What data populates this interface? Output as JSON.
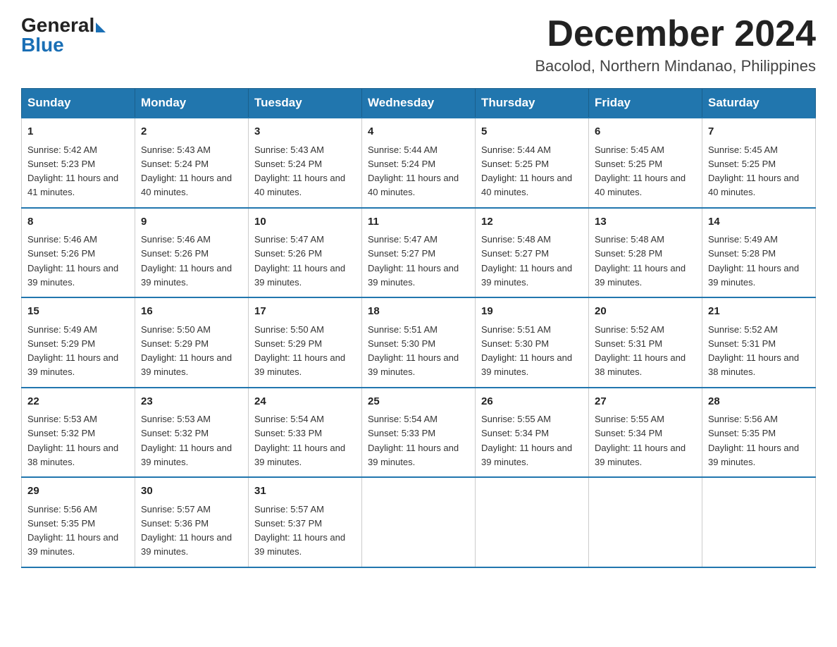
{
  "header": {
    "logo": {
      "line1": "General",
      "line2": "Blue",
      "arrow": true
    },
    "title": "December 2024",
    "subtitle": "Bacolod, Northern Mindanao, Philippines"
  },
  "days_of_week": [
    "Sunday",
    "Monday",
    "Tuesday",
    "Wednesday",
    "Thursday",
    "Friday",
    "Saturday"
  ],
  "weeks": [
    [
      {
        "day": "1",
        "sunrise": "5:42 AM",
        "sunset": "5:23 PM",
        "daylight": "11 hours and 41 minutes."
      },
      {
        "day": "2",
        "sunrise": "5:43 AM",
        "sunset": "5:24 PM",
        "daylight": "11 hours and 40 minutes."
      },
      {
        "day": "3",
        "sunrise": "5:43 AM",
        "sunset": "5:24 PM",
        "daylight": "11 hours and 40 minutes."
      },
      {
        "day": "4",
        "sunrise": "5:44 AM",
        "sunset": "5:24 PM",
        "daylight": "11 hours and 40 minutes."
      },
      {
        "day": "5",
        "sunrise": "5:44 AM",
        "sunset": "5:25 PM",
        "daylight": "11 hours and 40 minutes."
      },
      {
        "day": "6",
        "sunrise": "5:45 AM",
        "sunset": "5:25 PM",
        "daylight": "11 hours and 40 minutes."
      },
      {
        "day": "7",
        "sunrise": "5:45 AM",
        "sunset": "5:25 PM",
        "daylight": "11 hours and 40 minutes."
      }
    ],
    [
      {
        "day": "8",
        "sunrise": "5:46 AM",
        "sunset": "5:26 PM",
        "daylight": "11 hours and 39 minutes."
      },
      {
        "day": "9",
        "sunrise": "5:46 AM",
        "sunset": "5:26 PM",
        "daylight": "11 hours and 39 minutes."
      },
      {
        "day": "10",
        "sunrise": "5:47 AM",
        "sunset": "5:26 PM",
        "daylight": "11 hours and 39 minutes."
      },
      {
        "day": "11",
        "sunrise": "5:47 AM",
        "sunset": "5:27 PM",
        "daylight": "11 hours and 39 minutes."
      },
      {
        "day": "12",
        "sunrise": "5:48 AM",
        "sunset": "5:27 PM",
        "daylight": "11 hours and 39 minutes."
      },
      {
        "day": "13",
        "sunrise": "5:48 AM",
        "sunset": "5:28 PM",
        "daylight": "11 hours and 39 minutes."
      },
      {
        "day": "14",
        "sunrise": "5:49 AM",
        "sunset": "5:28 PM",
        "daylight": "11 hours and 39 minutes."
      }
    ],
    [
      {
        "day": "15",
        "sunrise": "5:49 AM",
        "sunset": "5:29 PM",
        "daylight": "11 hours and 39 minutes."
      },
      {
        "day": "16",
        "sunrise": "5:50 AM",
        "sunset": "5:29 PM",
        "daylight": "11 hours and 39 minutes."
      },
      {
        "day": "17",
        "sunrise": "5:50 AM",
        "sunset": "5:29 PM",
        "daylight": "11 hours and 39 minutes."
      },
      {
        "day": "18",
        "sunrise": "5:51 AM",
        "sunset": "5:30 PM",
        "daylight": "11 hours and 39 minutes."
      },
      {
        "day": "19",
        "sunrise": "5:51 AM",
        "sunset": "5:30 PM",
        "daylight": "11 hours and 39 minutes."
      },
      {
        "day": "20",
        "sunrise": "5:52 AM",
        "sunset": "5:31 PM",
        "daylight": "11 hours and 38 minutes."
      },
      {
        "day": "21",
        "sunrise": "5:52 AM",
        "sunset": "5:31 PM",
        "daylight": "11 hours and 38 minutes."
      }
    ],
    [
      {
        "day": "22",
        "sunrise": "5:53 AM",
        "sunset": "5:32 PM",
        "daylight": "11 hours and 38 minutes."
      },
      {
        "day": "23",
        "sunrise": "5:53 AM",
        "sunset": "5:32 PM",
        "daylight": "11 hours and 39 minutes."
      },
      {
        "day": "24",
        "sunrise": "5:54 AM",
        "sunset": "5:33 PM",
        "daylight": "11 hours and 39 minutes."
      },
      {
        "day": "25",
        "sunrise": "5:54 AM",
        "sunset": "5:33 PM",
        "daylight": "11 hours and 39 minutes."
      },
      {
        "day": "26",
        "sunrise": "5:55 AM",
        "sunset": "5:34 PM",
        "daylight": "11 hours and 39 minutes."
      },
      {
        "day": "27",
        "sunrise": "5:55 AM",
        "sunset": "5:34 PM",
        "daylight": "11 hours and 39 minutes."
      },
      {
        "day": "28",
        "sunrise": "5:56 AM",
        "sunset": "5:35 PM",
        "daylight": "11 hours and 39 minutes."
      }
    ],
    [
      {
        "day": "29",
        "sunrise": "5:56 AM",
        "sunset": "5:35 PM",
        "daylight": "11 hours and 39 minutes."
      },
      {
        "day": "30",
        "sunrise": "5:57 AM",
        "sunset": "5:36 PM",
        "daylight": "11 hours and 39 minutes."
      },
      {
        "day": "31",
        "sunrise": "5:57 AM",
        "sunset": "5:37 PM",
        "daylight": "11 hours and 39 minutes."
      },
      null,
      null,
      null,
      null
    ]
  ]
}
